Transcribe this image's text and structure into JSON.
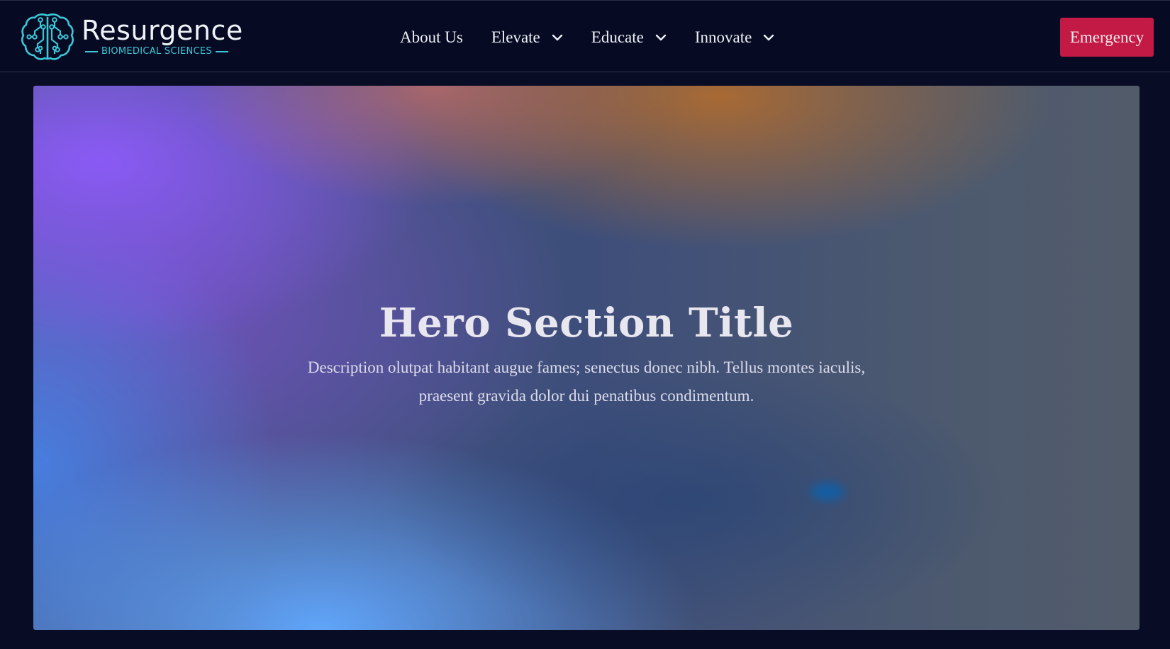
{
  "brand": {
    "name": "Resurgence",
    "tagline": "BIOMEDICAL SCIENCES",
    "logo_icon": "brain-circuit-icon",
    "accent": "#3cc8d8"
  },
  "nav": {
    "items": [
      {
        "label": "About Us",
        "has_dropdown": false
      },
      {
        "label": "Elevate",
        "has_dropdown": true
      },
      {
        "label": "Educate",
        "has_dropdown": true
      },
      {
        "label": "Innovate",
        "has_dropdown": true
      }
    ],
    "dropdown_icon": "chevron-down-icon"
  },
  "cta": {
    "label": "Emergency",
    "color": "#c21a45"
  },
  "hero": {
    "title": "Hero Section Title",
    "description": "Description olutpat habitant augue fames; senectus donec nibh. Tellus montes iaculis, praesent gravida dolor dui penatibus condimentum."
  },
  "colors": {
    "background": "#080c24",
    "header": "#060a23",
    "gradient_violet": "#8a5af5",
    "gradient_blue": "#60a5fa",
    "gradient_orange": "#ba6e28",
    "gradient_slate": "#525b6a"
  }
}
